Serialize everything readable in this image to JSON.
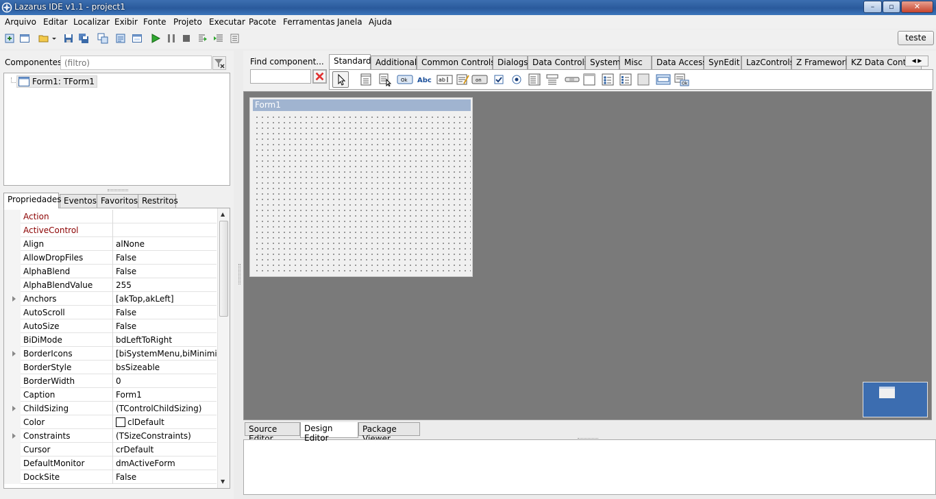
{
  "window": {
    "title": "Lazarus IDE v1.1 - project1",
    "min": "–",
    "max": "▫",
    "close": "✕"
  },
  "menu": [
    "Arquivo",
    "Editar",
    "Localizar",
    "Exibir",
    "Fonte",
    "Projeto",
    "Executar",
    "Pacote",
    "Ferramentas",
    "Janela",
    "Ajuda"
  ],
  "toolbar": {
    "teste_label": "teste"
  },
  "components": {
    "label": "Componentes",
    "filter_placeholder": "(filtro)",
    "tree_root": "Form1: TForm1"
  },
  "property_tabs": [
    "Propriedades",
    "Eventos",
    "Favoritos",
    "Restritos"
  ],
  "properties": [
    {
      "name": "Action",
      "value": ""
    },
    {
      "name": "ActiveControl",
      "value": ""
    },
    {
      "name": "Align",
      "value": "alNone"
    },
    {
      "name": "AllowDropFiles",
      "value": "False"
    },
    {
      "name": "AlphaBlend",
      "value": "False"
    },
    {
      "name": "AlphaBlendValue",
      "value": "255"
    },
    {
      "name": "Anchors",
      "value": "[akTop,akLeft]"
    },
    {
      "name": "AutoScroll",
      "value": "False"
    },
    {
      "name": "AutoSize",
      "value": "False"
    },
    {
      "name": "BiDiMode",
      "value": "bdLeftToRight"
    },
    {
      "name": "BorderIcons",
      "value": "[biSystemMenu,biMinimize,"
    },
    {
      "name": "BorderStyle",
      "value": "bsSizeable"
    },
    {
      "name": "BorderWidth",
      "value": "0"
    },
    {
      "name": "Caption",
      "value": "Form1"
    },
    {
      "name": "ChildSizing",
      "value": "(TControlChildSizing)"
    },
    {
      "name": "Color",
      "value": "clDefault"
    },
    {
      "name": "Constraints",
      "value": "(TSizeConstraints)"
    },
    {
      "name": "Cursor",
      "value": "crDefault"
    },
    {
      "name": "DefaultMonitor",
      "value": "dmActiveForm"
    },
    {
      "name": "DockSite",
      "value": "False"
    }
  ],
  "palette": {
    "find_label": "Find component...",
    "tabs": [
      "Standard",
      "Additional",
      "Common Controls",
      "Dialogs",
      "Data Controls",
      "System",
      "Misc",
      "Data Access",
      "SynEdit",
      "LazControls",
      "Z Framework",
      "KZ Data Contro"
    ]
  },
  "designer": {
    "form_caption": "Form1"
  },
  "editor_tabs": [
    "Source Editor",
    "Design Editor",
    "Package Viewer"
  ],
  "colors": {
    "title_bar": "#2a5a9c",
    "design_bg": "#7a7a7a",
    "form_caption": "#a0b4d0",
    "minimap": "#3c6db0",
    "error_red": "#e03030"
  }
}
